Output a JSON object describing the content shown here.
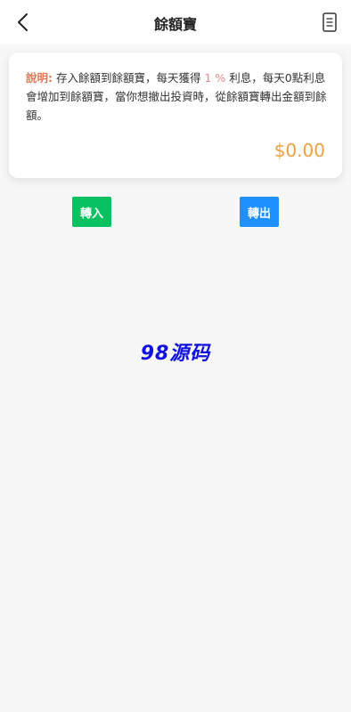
{
  "header": {
    "title": "餘額寶",
    "back_icon": "chevron-left-icon",
    "records_icon": "document-icon"
  },
  "card": {
    "desc_label": "說明:",
    "desc_part1": " 存入餘額到餘額寶，每天獲得 ",
    "desc_rate": "1 %",
    "desc_part2": " 利息，每天0點利息會增加到餘額寶，當你想撤出投資時，從餘額寶轉出金額到餘額。",
    "balance": "$0.00"
  },
  "actions": {
    "transfer_in": "轉入",
    "transfer_out": "轉出"
  },
  "watermark": "98源码",
  "colors": {
    "transfer_in_bg": "#07c160",
    "transfer_out_bg": "#1e90ff",
    "balance_color": "#f0a040",
    "label_color": "#e07a55",
    "watermark_color": "#1010e0"
  }
}
